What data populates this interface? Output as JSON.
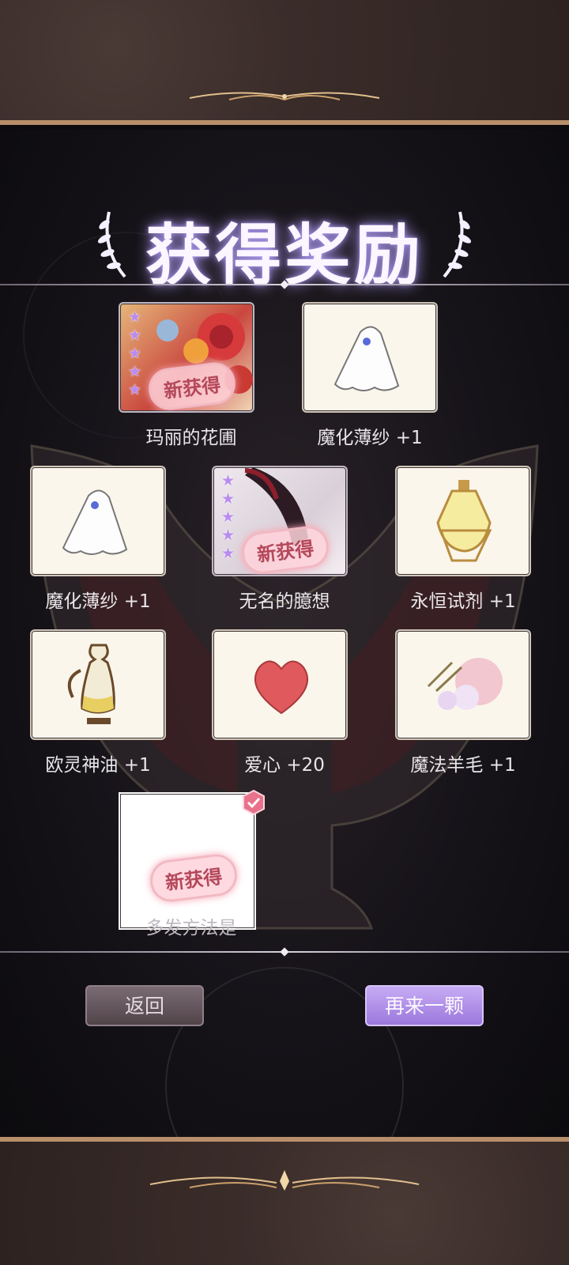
{
  "title": "获得奖励",
  "rewards": [
    {
      "name": "玛丽的花圃",
      "stars": 5,
      "badge": "新获得"
    },
    {
      "name": "魔化薄纱 +1"
    },
    {
      "name": "魔化薄纱 +1"
    },
    {
      "name": "无名的臆想",
      "stars": 5,
      "badge": "新获得"
    },
    {
      "name": "永恒试剂 +1"
    },
    {
      "name": "欧灵神油 +1"
    },
    {
      "name": "爱心 +20"
    },
    {
      "name": "魔法羊毛 +1"
    },
    {
      "name": "多发方法是",
      "badge": "新获得"
    }
  ],
  "buttons": {
    "back": "返回",
    "again": "再来一颗"
  },
  "icons": [
    "laurel-left-icon",
    "laurel-right-icon",
    "check-badge-icon",
    "star-icon",
    "veil-icon",
    "potion-icon",
    "oil-flask-icon",
    "heart-icon",
    "wool-icon"
  ],
  "colors": {
    "accent_purple": "#b38ef0",
    "heart": "#e0595c",
    "gold_frame": "#b88f6a"
  }
}
